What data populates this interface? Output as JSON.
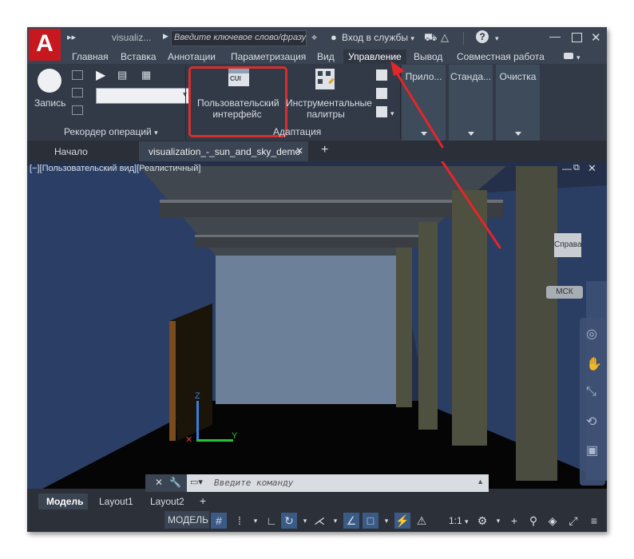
{
  "app": {
    "logo_letter": "A",
    "doc_short": "visualiz...",
    "search_placeholder": "Введите ключевое слово/фразу",
    "signin": "Вход в службы",
    "help": "?",
    "accent": "#c7181f"
  },
  "ribbon_tabs": [
    "Главная",
    "Вставка",
    "Аннотации",
    "Параметризация",
    "Вид",
    "Управление",
    "Вывод",
    "Совместная работа"
  ],
  "ribbon": {
    "record_label": "Запись",
    "recorder_panel": "Рекордер операций",
    "cui_icon_text": "CUI",
    "cui_label_1": "Пользовательский",
    "cui_label_2": "интерфейс",
    "toolpalettes_label_1": "Инструментальные",
    "toolpalettes_label_2": "палитры",
    "adaptation_panel": "Адаптация",
    "panel_apps": "Прило...",
    "panel_standards": "Станда...",
    "panel_cleanup": "Очистка"
  },
  "doc_tabs": {
    "start": "Начало",
    "active": "visualization_-_sun_and_sky_demo",
    "close": "✕",
    "add": "+"
  },
  "viewport": {
    "label": "[−][Пользовательский вид][Реалистичный]",
    "viewcube_face": "Справа",
    "ucs": "МСК",
    "axis_z": "Z",
    "axis_y": "Y"
  },
  "command": {
    "placeholder": "Введите команду"
  },
  "layout_tabs": [
    "Модель",
    "Layout1",
    "Layout2"
  ],
  "status": {
    "model": "МОДЕЛЬ",
    "scale": "1:1"
  }
}
